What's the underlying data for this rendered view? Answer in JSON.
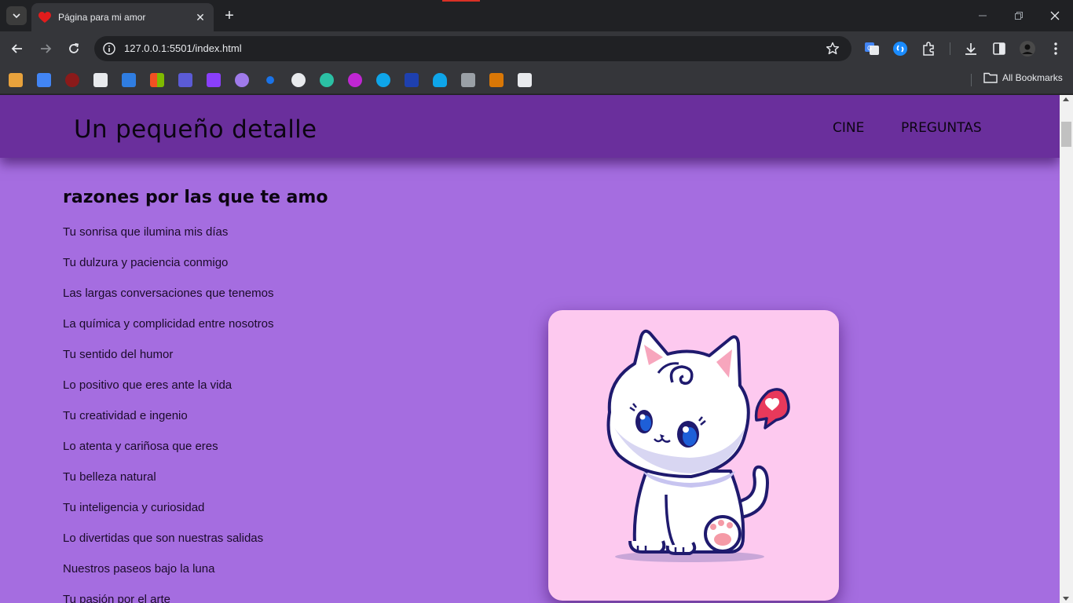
{
  "browser": {
    "tab_title": "Página para mi amor",
    "url": "127.0.0.1:5501/index.html",
    "bookmarks_label": "All Bookmarks",
    "accent": "#d93025"
  },
  "site": {
    "title": "Un pequeño detalle",
    "nav": [
      "CINE",
      "PREGUNTAS"
    ],
    "heading": "razones por las que te amo",
    "reasons": [
      "Tu sonrisa que ilumina mis días",
      "Tu dulzura y paciencia conmigo",
      "Las largas conversaciones que tenemos",
      "La química y complicidad entre nosotros",
      "Tu sentido del humor",
      "Lo positivo que eres ante la vida",
      "Tu creatividad e ingenio",
      "Lo atenta y cariñosa que eres",
      "Tu belleza natural",
      "Tu inteligencia y curiosidad",
      "Lo divertidas que son nuestras salidas",
      "Nuestros paseos bajo la luna",
      "Tu pasión por el arte"
    ],
    "colors": {
      "page_bg": "#a56de0",
      "header_bg": "#6a2f9c",
      "card_bg": "#fdc9ef"
    },
    "image_subject": "white-kitten-with-heart-speech-bubble"
  }
}
